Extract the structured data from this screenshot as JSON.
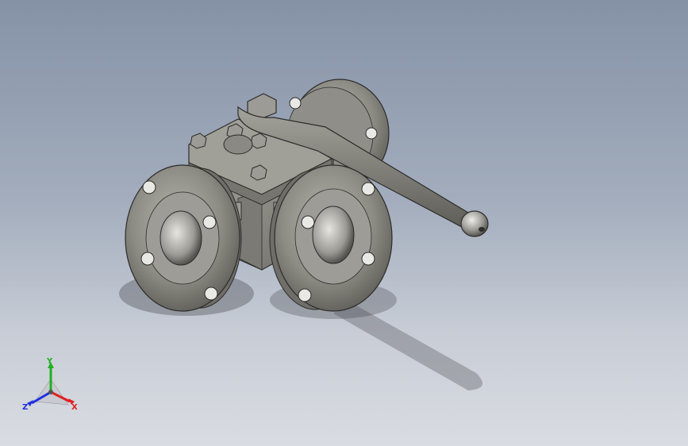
{
  "view": {
    "background_top": "#8592a6",
    "background_bottom": "#d9dce2",
    "model_color": "#8a8a86",
    "model_shadow": "#3f4046"
  },
  "triad": {
    "x_label": "X",
    "y_label": "Y",
    "z_label": "Z",
    "x_color": "#e02020",
    "y_color": "#20b020",
    "z_color": "#2030e0"
  }
}
